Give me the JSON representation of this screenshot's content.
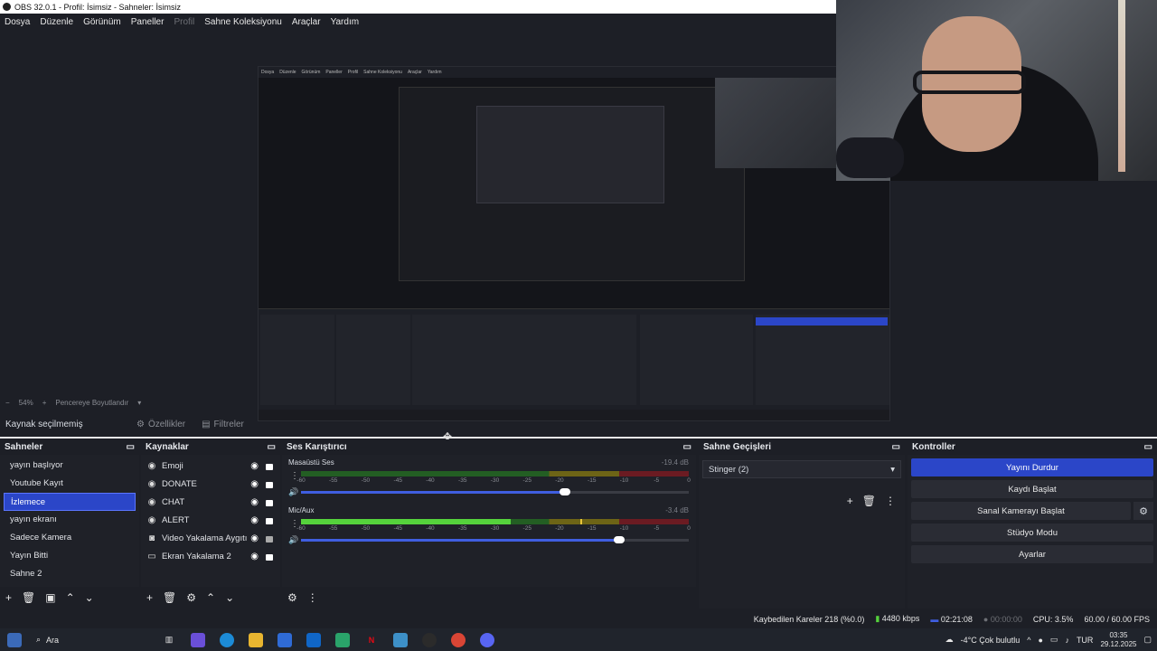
{
  "window": {
    "title": "OBS 32.0.1 - Profil: İsimsiz - Sahneler: İsimsiz"
  },
  "menu": {
    "items": [
      {
        "label": "Dosya",
        "disabled": false
      },
      {
        "label": "Düzenle",
        "disabled": false
      },
      {
        "label": "Görünüm",
        "disabled": false
      },
      {
        "label": "Paneller",
        "disabled": false
      },
      {
        "label": "Profil",
        "disabled": true
      },
      {
        "label": "Sahne Koleksiyonu",
        "disabled": false
      },
      {
        "label": "Araçlar",
        "disabled": false
      },
      {
        "label": "Yardım",
        "disabled": false
      }
    ]
  },
  "preview": {
    "zoom": "54%",
    "fit_label": "Pencereye Boyutlandır"
  },
  "source_bar": {
    "no_source": "Kaynak seçilmemiş",
    "properties": "Özellikler",
    "filters": "Filtreler"
  },
  "scenes": {
    "title": "Sahneler",
    "items": [
      {
        "label": "yayın başlıyor",
        "selected": false
      },
      {
        "label": "Youtube Kayıt",
        "selected": false
      },
      {
        "label": "İzlemece",
        "selected": true
      },
      {
        "label": "yayın ekranı",
        "selected": false
      },
      {
        "label": "Sadece Kamera",
        "selected": false
      },
      {
        "label": "Yayın Bitti",
        "selected": false
      },
      {
        "label": "Sahne 2",
        "selected": false
      }
    ]
  },
  "sources": {
    "title": "Kaynaklar",
    "items": [
      {
        "label": "Emoji",
        "icon": "browser-icon",
        "locked": true
      },
      {
        "label": "DONATE",
        "icon": "browser-icon",
        "locked": true
      },
      {
        "label": "CHAT",
        "icon": "browser-icon",
        "locked": true
      },
      {
        "label": "ALERT",
        "icon": "browser-icon",
        "locked": true
      },
      {
        "label": "Video Yakalama Aygıtı",
        "icon": "camera-icon",
        "locked": false
      },
      {
        "label": "Ekran Yakalama 2",
        "icon": "monitor-icon",
        "locked": true
      }
    ]
  },
  "mixer": {
    "title": "Ses Karıştırıcı",
    "ticks": [
      "-60",
      "-55",
      "-50",
      "-45",
      "-40",
      "-35",
      "-30",
      "-25",
      "-20",
      "-15",
      "-10",
      "-5",
      "0"
    ],
    "channels": [
      {
        "name": "Masaüstü Ses",
        "db": "-19.4 dB",
        "level": 0,
        "peak": 0,
        "volume": 0.68
      },
      {
        "name": "Mic/Aux",
        "db": "-3.4 dB",
        "level": 0.54,
        "peak": 0.72,
        "volume": 0.82
      }
    ]
  },
  "transitions": {
    "title": "Sahne Geçişleri",
    "selected": "Stinger (2)"
  },
  "controls": {
    "title": "Kontroller",
    "stop_stream": "Yayını Durdur",
    "start_record": "Kaydı Başlat",
    "virtual_cam": "Sanal Kamerayı Başlat",
    "studio_mode": "Stüdyo Modu",
    "settings": "Ayarlar"
  },
  "status": {
    "dropped": "Kaybedilen Kareler 218 (%0.0)",
    "bitrate": "4480 kbps",
    "stream_time": "02:21:08",
    "record_time": "00:00:00",
    "cpu": "CPU: 3.5%",
    "fps": "60.00 / 60.00 FPS"
  },
  "taskbar": {
    "search": "Ara",
    "weather": "-4°C  Çok bulutlu",
    "lang": "TUR",
    "time": "03:35",
    "date": "29.12.2025"
  },
  "colors": {
    "accent": "#2b46c8",
    "background": "#1d1f26"
  }
}
